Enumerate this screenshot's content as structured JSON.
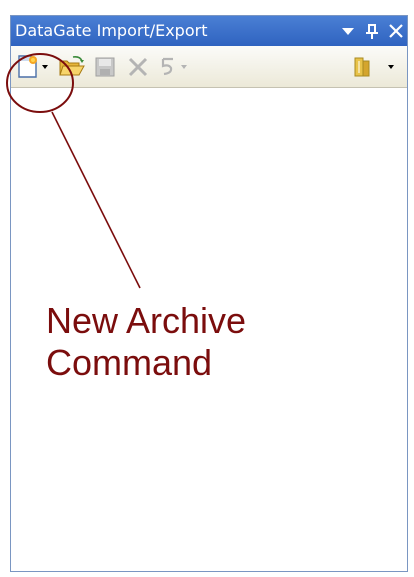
{
  "window": {
    "title": "DataGate Import/Export"
  },
  "title_buttons": {
    "dropdown_icon": "triangle-down",
    "pin_icon": "pin",
    "close_icon": "x"
  },
  "toolbar": {
    "items": [
      {
        "name": "new-archive",
        "icon": "new-document-star",
        "enabled": true,
        "has_dropdown": true
      },
      {
        "name": "open",
        "icon": "open-folder",
        "enabled": true
      },
      {
        "name": "save",
        "icon": "floppy-disk",
        "enabled": false
      },
      {
        "name": "delete",
        "icon": "x-mark",
        "enabled": false
      },
      {
        "name": "undo",
        "icon": "undo-arrow",
        "enabled": false,
        "has_dropdown": true
      },
      {
        "name": "library",
        "icon": "books",
        "enabled": true,
        "has_dropdown": true
      }
    ]
  },
  "annotation": {
    "line1": "New Archive",
    "line2": "Command",
    "color": "#7b0d0d"
  },
  "colors": {
    "titlebar": "#3a6fcf",
    "toolbar": "#ece9d8",
    "border": "#7a96c2"
  }
}
